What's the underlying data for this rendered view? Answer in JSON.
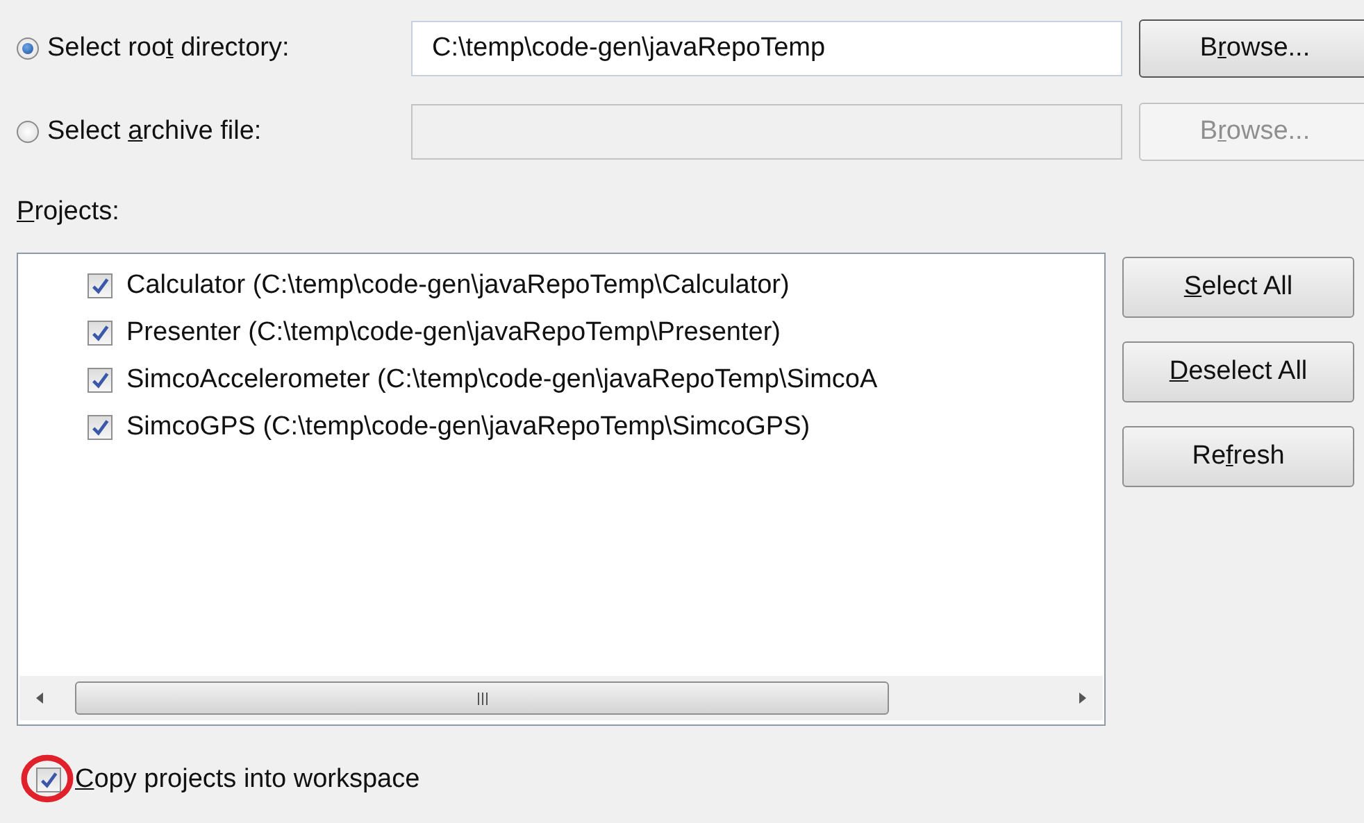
{
  "source_options": [
    {
      "label": {
        "pre": "Select roo",
        "key": "t",
        "post": " directory:"
      },
      "selected": true,
      "path": "C:\\temp\\code-gen\\javaRepoTemp",
      "browse": {
        "pre": "B",
        "key": "r",
        "post": "owse..."
      },
      "disabled": false
    },
    {
      "label": {
        "pre": "Select ",
        "key": "a",
        "post": "rchive file:"
      },
      "selected": false,
      "browse": {
        "pre": "B",
        "key": "r",
        "post": "owse..."
      },
      "disabled": true
    }
  ],
  "projects_label": {
    "key": "P",
    "post": "rojects:"
  },
  "projects": [
    {
      "label": "Calculator (C:\\temp\\code-gen\\javaRepoTemp\\Calculator)",
      "checked": true
    },
    {
      "label": "Presenter (C:\\temp\\code-gen\\javaRepoTemp\\Presenter)",
      "checked": true
    },
    {
      "label": "SimcoAccelerometer (C:\\temp\\code-gen\\javaRepoTemp\\SimcoA",
      "checked": true
    },
    {
      "label": "SimcoGPS (C:\\temp\\code-gen\\javaRepoTemp\\SimcoGPS)",
      "checked": true
    }
  ],
  "project_buttons": [
    {
      "key": "S",
      "post": "elect All"
    },
    {
      "key": "D",
      "post": "eselect All"
    },
    {
      "pre": "Re",
      "key": "f",
      "post": "resh"
    }
  ],
  "copy_option": {
    "label": {
      "key": "C",
      "post": "opy projects into workspace"
    },
    "checked": true,
    "highlighted": true
  }
}
